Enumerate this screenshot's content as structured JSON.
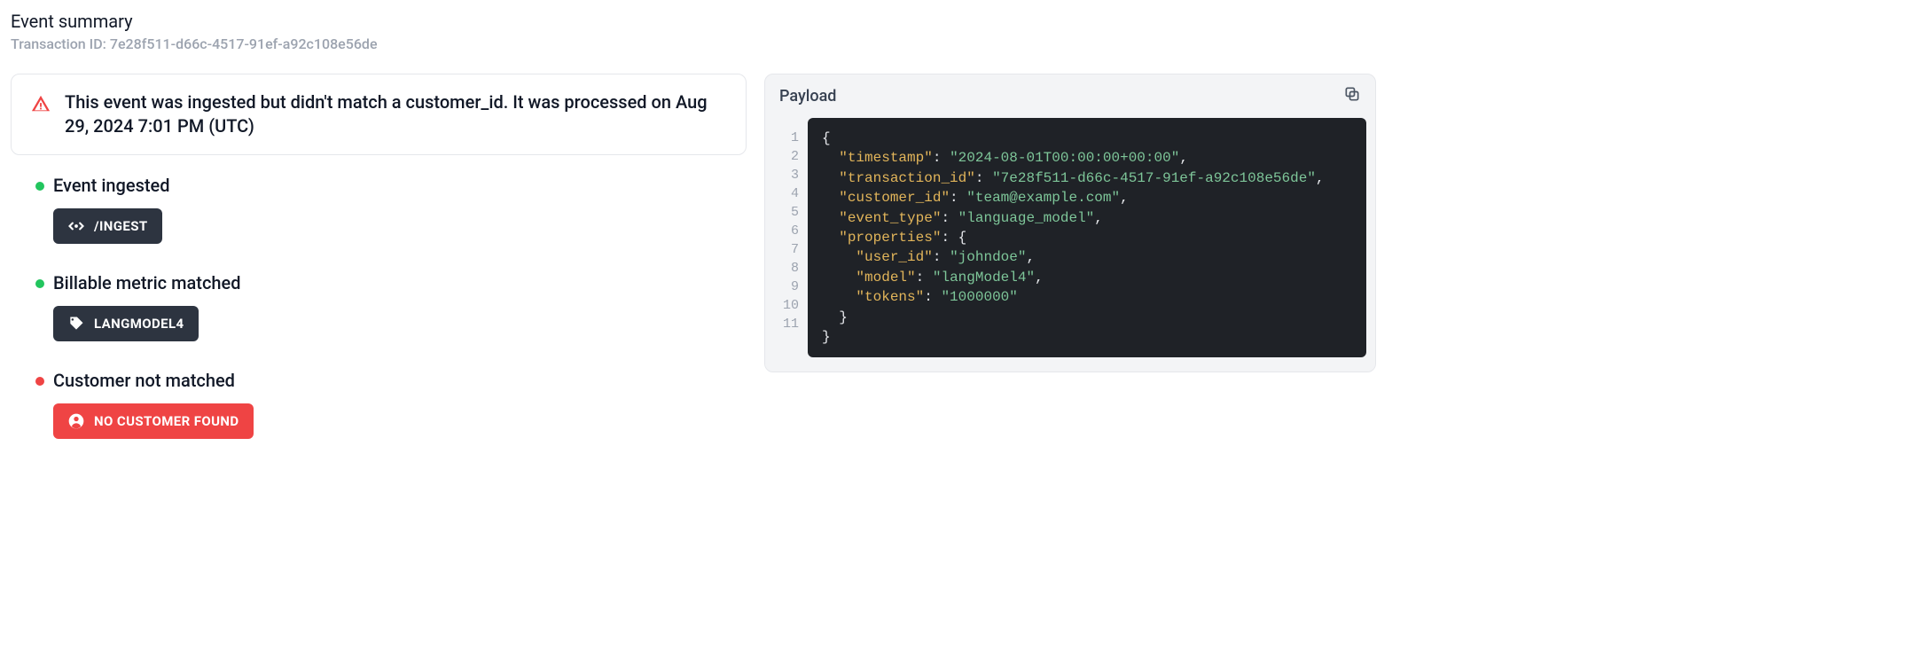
{
  "header": {
    "title": "Event summary",
    "transaction_id_label": "Transaction ID:",
    "transaction_id": "7e28f511-d66c-4517-91ef-a92c108e56de"
  },
  "alert": {
    "message": "This event was ingested but didn't match a customer_id. It was processed on Aug 29, 2024 7:01 PM (UTC)"
  },
  "steps": [
    {
      "status": "green",
      "title": "Event ingested",
      "pill_style": "dark",
      "pill_label": "/INGEST",
      "icon": "code"
    },
    {
      "status": "green",
      "title": "Billable metric matched",
      "pill_style": "dark",
      "pill_label": "LANGMODEL4",
      "icon": "tag"
    },
    {
      "status": "red",
      "title": "Customer not matched",
      "pill_style": "red",
      "pill_label": "NO CUSTOMER FOUND",
      "icon": "user"
    }
  ],
  "payload_panel": {
    "title": "Payload"
  },
  "payload": {
    "timestamp": "2024-08-01T00:00:00+00:00",
    "transaction_id": "7e28f511-d66c-4517-91ef-a92c108e56de",
    "customer_id": "team@example.com",
    "event_type": "language_model",
    "properties": {
      "user_id": "johndoe",
      "model": "langModel4",
      "tokens": "1000000"
    }
  }
}
